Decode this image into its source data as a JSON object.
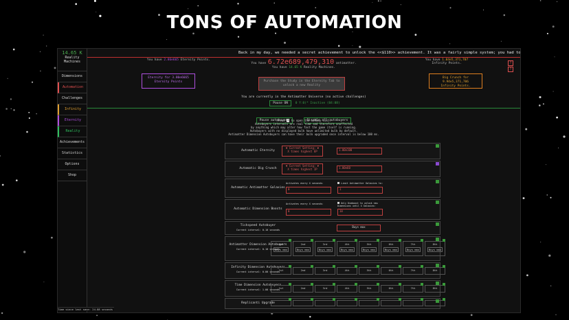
{
  "banner": "TONS OF AUTOMATION",
  "sidebar": {
    "rm_value": "14.65 K",
    "rm_label1": "Reality",
    "rm_label2": "Machines",
    "items": [
      "Dimensions",
      "Automation",
      "Challenges",
      "Infinity",
      "Eternity",
      "Reality",
      "Achievements",
      "Statistics",
      "Options",
      "Shop"
    ]
  },
  "news": "Back in my day, we needed a secret achievement to unlock the <<$110>> achievement. It was a fairly simple system; you had to find a",
  "header": {
    "ep_pre": "You have",
    "ep_val": "2.86e665",
    "ep_post": "Eternity Points.",
    "am_pre": "You have",
    "am_val": "6.72e689,479,310",
    "am_post": "antimatter.",
    "rm_pre": "You have",
    "rm_val": "14.65 K",
    "rm_post": "Reality Machines.",
    "ip_pre": "You have",
    "ip_val": "1.04e5,371,707",
    "ip_post": "Infinity Points."
  },
  "buttons": {
    "eternity": "Eternity for 3.80e6665 Eternity Points",
    "reality": "Purchase the Study in the Eternity Tab to unlock a new Reality",
    "crunch_pre": "Big Crunch for",
    "crunch_val": "9.94e5,371,706",
    "crunch_post": "Infinity Points."
  },
  "challenge": {
    "text": "You are currently in the Antimatter Universe (no active challenges)",
    "pause": "Pause ON",
    "inactive": "0 Y:0(* Inactive (04:08)"
  },
  "auto_buttons": {
    "pause": "Pause autobuyers",
    "disable": "Disable all autobuyers"
  },
  "info": {
    "l1_a": "Press",
    "l1_key": "?",
    "l1_b": "to open the hotkey list.",
    "l2": "Autobuyers intervals are real time and therefore unaffected",
    "l3": "by anything which may alter how fast the game itself is running.",
    "l4": "Autobuyers with no displayed bulk have unlimited bulk by default.",
    "l5": "Antimatter Dimension Autobuyers can have their bulk upgraded once interval is below 100 ms."
  },
  "rows": {
    "eternity": {
      "label": "Automatic Eternity",
      "setting": "▼ Current Setting: ▼",
      "sub": "X times highest EP",
      "value": "1.00e100"
    },
    "crunch": {
      "label": "Automatic Big Crunch",
      "setting": "▼ Current Setting: ▼",
      "sub": "X times highest IP",
      "value": "1.00e60"
    },
    "galaxies": {
      "label": "Automatic Antimatter Galaxies",
      "note": "Activates every X seconds:",
      "limit": "Limit Antimatter Galaxies to:",
      "v1": "0",
      "v2": "1"
    },
    "boosts": {
      "label": "Automatic Dimension Boosts",
      "note": "Activates every X seconds:",
      "limit": "Only Dimboost to unlock new Dimensions until X Galaxies:",
      "v1": "0",
      "v2": "10"
    },
    "tickspeed": {
      "label": "Tickspeed Autobuyer",
      "sub": "Current interval: 0.10 seconds",
      "mode": "Buys max"
    },
    "ad": {
      "label": "Antimatter Dimension Autobuyers",
      "sub": "Current interval: 0.10 seconds"
    },
    "id": {
      "label": "Infinity Dimension Autobuyers",
      "sub": "Current interval: 0.00 seconds"
    },
    "td": {
      "label": "Time Dimension Autobuyers",
      "sub": "Current interval: 1.00 seconds"
    },
    "rep": {
      "label": "Replicanti Upgrade"
    }
  },
  "dims": [
    "1st",
    "2nd",
    "3rd",
    "4th",
    "5th",
    "6th",
    "7th",
    "8th"
  ],
  "buy_max": "Buys max",
  "time_since": "Time since last save: 24.88 seconds"
}
